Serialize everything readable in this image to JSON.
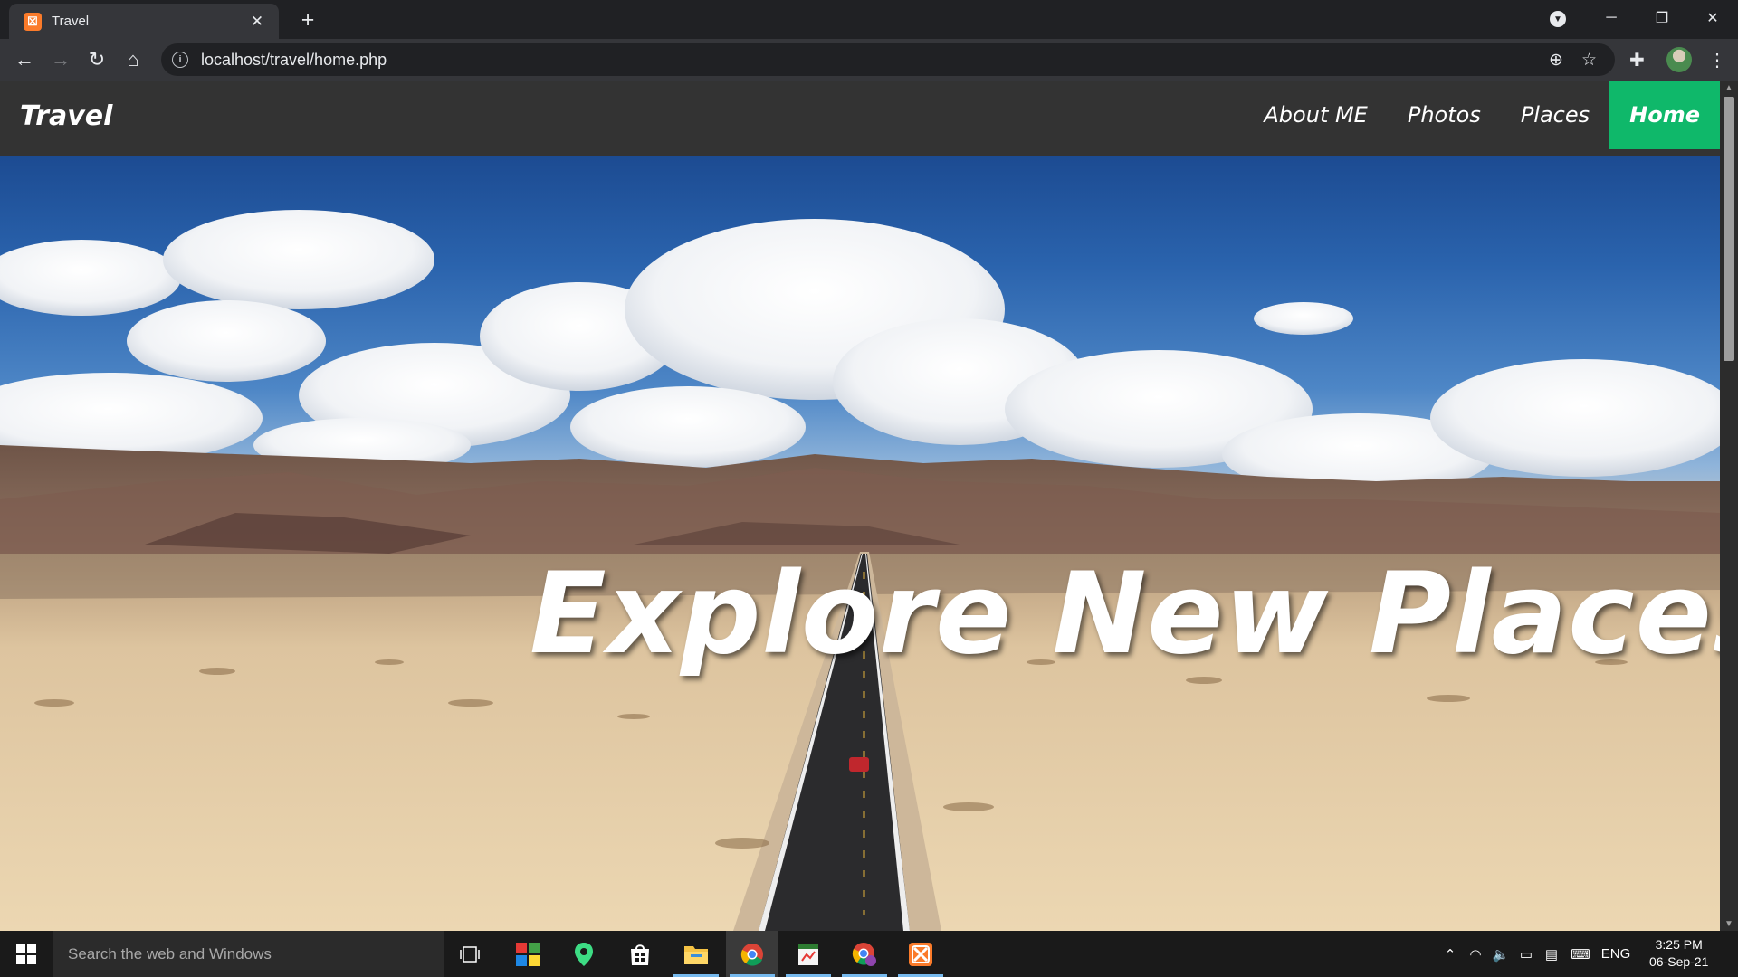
{
  "browser": {
    "tab_title": "Travel",
    "tab_favicon": "xampp-icon",
    "tab_close": "✕",
    "new_tab": "+",
    "url": "localhost/travel/home.php",
    "window_controls": {
      "minimize": "─",
      "restore": "❐",
      "close": "✕"
    }
  },
  "page": {
    "brand": "Travel",
    "nav": [
      {
        "label": "About ME",
        "active": false
      },
      {
        "label": "Photos",
        "active": false
      },
      {
        "label": "Places",
        "active": false
      },
      {
        "label": "Home",
        "active": true
      }
    ],
    "headline": "Explore New Places.",
    "colors": {
      "navbar_bg": "#333333",
      "active_nav": "#0fb86a"
    }
  },
  "taskbar": {
    "search_placeholder": "Search the web and Windows",
    "apps": [
      "task-view-icon",
      "colorful-tiles-app-icon",
      "maps-pin-app-icon",
      "store-icon",
      "file-explorer-icon",
      "chrome-icon",
      "spreadsheet-app-icon",
      "chrome-profile-icon",
      "xampp-icon"
    ],
    "language": "ENG",
    "time": "3:25 PM",
    "date": "06-Sep-21"
  }
}
